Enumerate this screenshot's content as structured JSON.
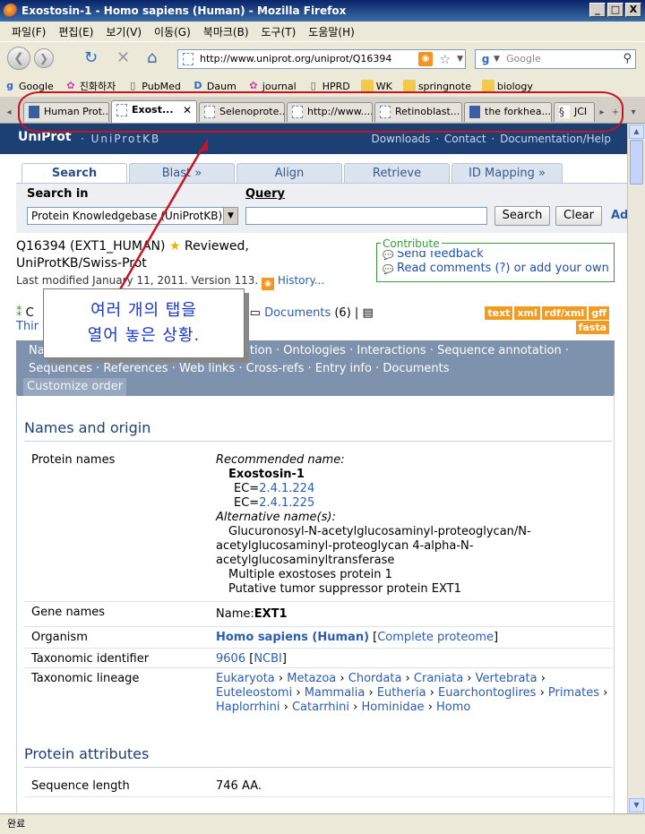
{
  "window": {
    "title": "Exostosin-1 - Homo sapiens (Human) - Mozilla Firefox",
    "buttons": [
      "_",
      "□",
      "X"
    ]
  },
  "menu": [
    "파일(F)",
    "편집(E)",
    "보기(V)",
    "이동(G)",
    "북마크(B)",
    "도구(T)",
    "도움말(H)"
  ],
  "nav": {
    "url": "http://www.uniprot.org/uniprot/Q16394",
    "search_placeholder": "Google"
  },
  "bookmarks": [
    "Google",
    "진화하자",
    "PubMed",
    "Daum",
    "journal",
    "HPRD",
    "WK",
    "springnote",
    "biology"
  ],
  "tabs": [
    "Human Prot...",
    "Exost...",
    "Selenoprote...",
    "http://www....",
    "Retinoblast...",
    "the forkhea...",
    "JCI"
  ],
  "header": {
    "logo": "UniProt",
    "product": "UniProtKB",
    "links": [
      "Downloads",
      "·",
      "Contact",
      "·",
      "Documentation/Help"
    ]
  },
  "search_tabs": [
    "Search",
    "Blast »",
    "Align",
    "Retrieve",
    "ID Mapping »"
  ],
  "query": {
    "search_in_label": "Search in",
    "query_label": "Query",
    "database": "Protein Knowledgebase (UniProtKB)",
    "search_btn": "Search",
    "clear_btn": "Clear",
    "advanced": "Ad"
  },
  "entry": {
    "accession": "Q16394",
    "name": "(EXT1_HUMAN)",
    "status": "Reviewed,",
    "db": "UniProtKB/Swiss-Prot",
    "modified": "Last modified January 11, 2011. Version 113.",
    "history": "History..."
  },
  "contribute": {
    "header": "Contribute",
    "feedback": "Send feedback",
    "comments": "Read comments (?) or add your own"
  },
  "docline": {
    "left1": "C",
    "left2": "Thir",
    "right_sep": "e",
    "documents": "Documents",
    "doc_count": "(6)"
  },
  "formats": [
    "text",
    "xml",
    "rdf/xml",
    "gff",
    "fasta"
  ],
  "nav_panel": {
    "row1": [
      "Na",
      "tation",
      "·",
      "Ontologies",
      "·",
      "Interactions",
      "·",
      "Sequence annotation",
      "·"
    ],
    "row2": [
      "Sequences",
      "·",
      "References",
      "·",
      "Web links",
      "·",
      "Cross-refs",
      "·",
      "Entry info",
      "·",
      "Documents"
    ],
    "customize": "Customize order"
  },
  "names_section": {
    "title": "Names and origin",
    "protein_names_label": "Protein names",
    "recommended": "Recommended name:",
    "protein": "Exostosin-1",
    "ec_prefix": "EC=",
    "ec1": "2.4.1.224",
    "ec2": "2.4.1.225",
    "alternative": "Alternative name(s):",
    "alt1": "Glucuronosyl-N-acetylglucosaminyl-proteoglycan/N-acetylglucosaminyl-proteoglycan 4-alpha-N-acetylglucosaminyltransferase",
    "alt2": "Multiple exostoses protein 1",
    "alt3": "Putative tumor suppressor protein EXT1",
    "gene_label": "Gene names",
    "gene_prefix": "Name:",
    "gene": "EXT1",
    "organism_label": "Organism",
    "organism": "Homo sapiens (Human)",
    "complete_proteome": "Complete proteome",
    "taxid_label": "Taxonomic identifier",
    "taxid": "9606",
    "ncbi": "NCBI",
    "lineage_label": "Taxonomic lineage",
    "lineage": [
      "Eukaryota",
      "Metazoa",
      "Chordata",
      "Craniata",
      "Vertebrata",
      "Euteleostomi",
      "Mammalia",
      "Eutheria",
      "Euarchontoglires",
      "Primates",
      "Haplorrhini",
      "Catarrhini",
      "Hominidae",
      "Homo"
    ]
  },
  "attributes_section": {
    "title": "Protein attributes",
    "seq_length_label": "Sequence length",
    "seq_length": "746 AA."
  },
  "annotation": {
    "line1": "여러 개의 탭을",
    "line2": "열어 놓은 상황."
  },
  "status": "완료",
  "colors": {
    "annotation_red": "#c8141e",
    "header_blue": "#1c3f74",
    "link": "#2a5db0",
    "format_orange": "#f29b1e"
  }
}
